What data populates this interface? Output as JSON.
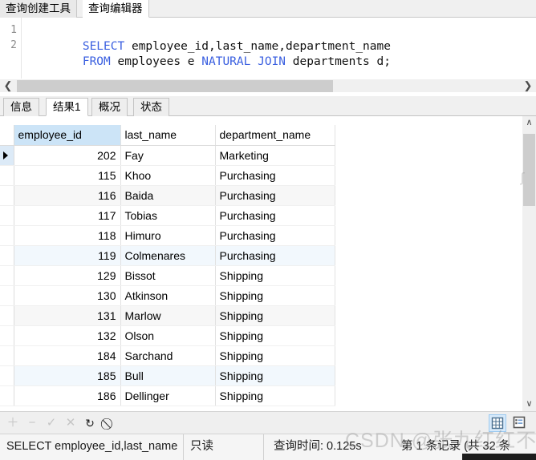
{
  "top_tabs": [
    {
      "label": "查询创建工具",
      "active": false
    },
    {
      "label": "查询编辑器",
      "active": true
    }
  ],
  "editor": {
    "gutter": [
      "1",
      "2"
    ],
    "lines": [
      {
        "parts": [
          {
            "text": "SELECT",
            "kind": "keyword"
          },
          {
            "text": " employee_id,last_name,department_name",
            "kind": "plain"
          }
        ]
      },
      {
        "parts": [
          {
            "text": "FROM",
            "kind": "keyword"
          },
          {
            "text": " employees e ",
            "kind": "plain"
          },
          {
            "text": "NATURAL JOIN",
            "kind": "keyword"
          },
          {
            "text": " departments d;",
            "kind": "plain"
          }
        ]
      }
    ],
    "scroll_left_icon": "❮",
    "scroll_right_icon": "❯"
  },
  "result_tabs": [
    {
      "label": "信息",
      "active": false
    },
    {
      "label": "结果1",
      "active": true
    },
    {
      "label": "概况",
      "active": false
    },
    {
      "label": "状态",
      "active": false
    }
  ],
  "grid": {
    "columns": [
      "employee_id",
      "last_name",
      "department_name"
    ],
    "selected_column": "employee_id",
    "rows": [
      {
        "employee_id": "202",
        "last_name": "Fay",
        "department_name": "Marketing",
        "band": "none",
        "current": true
      },
      {
        "employee_id": "115",
        "last_name": "Khoo",
        "department_name": "Purchasing",
        "band": "none",
        "current": false
      },
      {
        "employee_id": "116",
        "last_name": "Baida",
        "department_name": "Purchasing",
        "band": "grey",
        "current": false
      },
      {
        "employee_id": "117",
        "last_name": "Tobias",
        "department_name": "Purchasing",
        "band": "none",
        "current": false
      },
      {
        "employee_id": "118",
        "last_name": "Himuro",
        "department_name": "Purchasing",
        "band": "none",
        "current": false
      },
      {
        "employee_id": "119",
        "last_name": "Colmenares",
        "department_name": "Purchasing",
        "band": "blue",
        "current": false
      },
      {
        "employee_id": "129",
        "last_name": "Bissot",
        "department_name": "Shipping",
        "band": "none",
        "current": false
      },
      {
        "employee_id": "130",
        "last_name": "Atkinson",
        "department_name": "Shipping",
        "band": "none",
        "current": false
      },
      {
        "employee_id": "131",
        "last_name": "Marlow",
        "department_name": "Shipping",
        "band": "grey",
        "current": false
      },
      {
        "employee_id": "132",
        "last_name": "Olson",
        "department_name": "Shipping",
        "band": "none",
        "current": false
      },
      {
        "employee_id": "184",
        "last_name": "Sarchand",
        "department_name": "Shipping",
        "band": "none",
        "current": false
      },
      {
        "employee_id": "185",
        "last_name": "Bull",
        "department_name": "Shipping",
        "band": "blue",
        "current": false
      },
      {
        "employee_id": "186",
        "last_name": "Dellinger",
        "department_name": "Shipping",
        "band": "none",
        "current": false
      }
    ],
    "scroll_up_icon": "∧",
    "scroll_down_icon": "∨"
  },
  "toolbar": {
    "icons": [
      {
        "name": "add-record-icon",
        "glyph": "＋",
        "enabled": false
      },
      {
        "name": "remove-record-icon",
        "glyph": "−",
        "enabled": false
      },
      {
        "name": "apply-change-icon",
        "glyph": "✓",
        "enabled": false
      },
      {
        "name": "cancel-change-icon",
        "glyph": "✕",
        "enabled": false
      },
      {
        "name": "refresh-icon",
        "glyph": "↻",
        "enabled": true
      },
      {
        "name": "stop-icon",
        "glyph": "⃠",
        "enabled": true
      }
    ],
    "view_grid_label": "grid-view-icon",
    "view_form_label": "form-view-icon"
  },
  "status": {
    "sql": "SELECT employee_id,last_name",
    "mode": "只读",
    "query_time": "查询时间: 0.125s",
    "records": "第 1 条记录 (共 32 条"
  },
  "watermark": {
    "text": "CSDN @张九红红不耍儿",
    "edge_fragment": "ʃ"
  }
}
